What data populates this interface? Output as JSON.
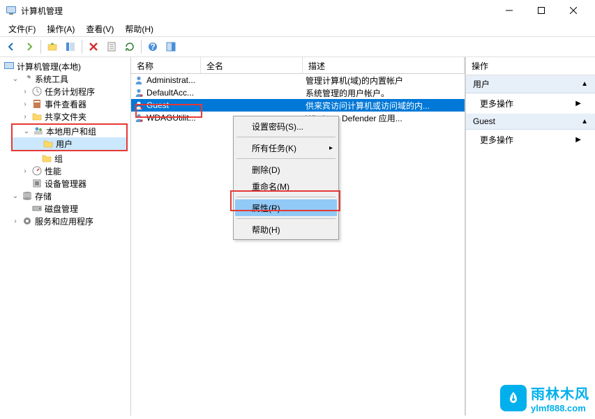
{
  "window": {
    "title": "计算机管理"
  },
  "menubar": {
    "file": "文件(F)",
    "action": "操作(A)",
    "view": "查看(V)",
    "help": "帮助(H)"
  },
  "tree": {
    "root": "计算机管理(本地)",
    "systools": "系统工具",
    "scheduler": "任务计划程序",
    "eventviewer": "事件查看器",
    "shared": "共享文件夹",
    "localusers": "本地用户和组",
    "users": "用户",
    "groups": "组",
    "performance": "性能",
    "devmgr": "设备管理器",
    "storage": "存储",
    "diskmgmt": "磁盘管理",
    "services": "服务和应用程序"
  },
  "list": {
    "columns": {
      "name": "名称",
      "fullname": "全名",
      "desc": "描述"
    },
    "rows": [
      {
        "name": "Administrat...",
        "fullname": "",
        "desc": "管理计算机(域)的内置帐户"
      },
      {
        "name": "DefaultAcc...",
        "fullname": "",
        "desc": "系统管理的用户帐户。"
      },
      {
        "name": "Guest",
        "fullname": "",
        "desc": "供来宾访问计算机或访问域的内..."
      },
      {
        "name": "WDAGUtilit...",
        "fullname": "",
        "desc": "Windows Defender 应用..."
      }
    ]
  },
  "context_menu": {
    "set_password": "设置密码(S)...",
    "all_tasks": "所有任务(K)",
    "delete": "删除(D)",
    "rename": "重命名(M)",
    "properties": "属性(R)",
    "help": "帮助(H)"
  },
  "action_panel": {
    "header": "操作",
    "section1": "用户",
    "more1": "更多操作",
    "section2": "Guest",
    "more2": "更多操作"
  },
  "watermark": {
    "main": "雨林木风",
    "sub": "ylmf888.com"
  }
}
